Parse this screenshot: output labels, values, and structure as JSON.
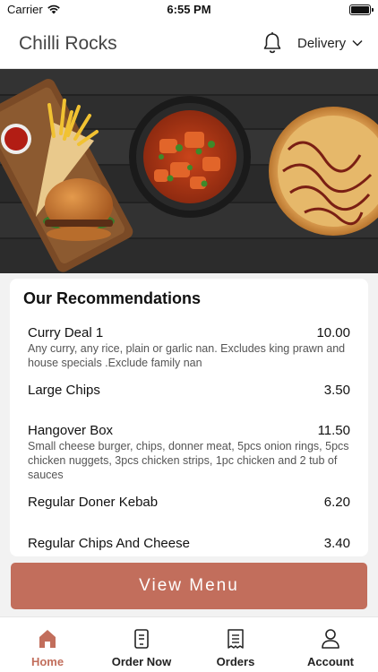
{
  "status_bar": {
    "carrier": "Carrier",
    "time": "6:55 PM"
  },
  "header": {
    "title": "Chilli Rocks",
    "delivery_label": "Delivery"
  },
  "hero": {
    "image": "food-banner"
  },
  "recommendations": {
    "title": "Our Recommendations",
    "items": [
      {
        "name": "Curry Deal 1",
        "price": "10.00",
        "description": "Any curry, any rice, plain or garlic nan. Excludes king prawn and house specials .Exclude family nan"
      },
      {
        "name": "Large Chips",
        "price": "3.50",
        "description": ""
      },
      {
        "name": "Hangover Box",
        "price": "11.50",
        "description": "Small cheese burger, chips, donner meat, 5pcs onion rings, 5pcs chicken nuggets, 3pcs chicken strips, 1pc chicken and 2 tub of sauces"
      },
      {
        "name": "Regular Doner Kebab",
        "price": "6.20",
        "description": ""
      },
      {
        "name": "Regular Chips And Cheese",
        "price": "3.40",
        "description": ""
      }
    ]
  },
  "view_menu_label": "View Menu",
  "tabs": [
    {
      "label": "Home",
      "icon": "home-icon",
      "active": true
    },
    {
      "label": "Order Now",
      "icon": "order-icon",
      "active": false
    },
    {
      "label": "Orders",
      "icon": "receipt-icon",
      "active": false
    },
    {
      "label": "Account",
      "icon": "user-icon",
      "active": false
    }
  ],
  "colors": {
    "accent": "#c26e5c",
    "background": "#f2f2f2"
  }
}
